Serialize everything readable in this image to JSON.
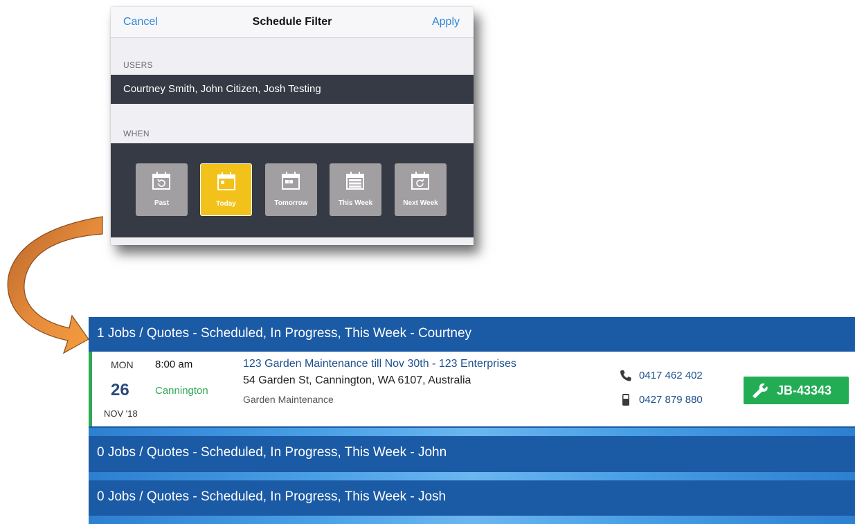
{
  "filter": {
    "cancel_label": "Cancel",
    "title": "Schedule Filter",
    "apply_label": "Apply",
    "users_label": "USERS",
    "users_value": "Courtney Smith, John Citizen, Josh Testing",
    "when_label": "WHEN",
    "when_options": [
      {
        "label": "Past",
        "icon": "calendar-past-icon",
        "selected": false
      },
      {
        "label": "Today",
        "icon": "calendar-today-icon",
        "selected": true
      },
      {
        "label": "Tomorrow",
        "icon": "calendar-tomorrow-icon",
        "selected": false
      },
      {
        "label": "This  Week",
        "icon": "calendar-week-icon",
        "selected": false
      },
      {
        "label": "Next Week",
        "icon": "calendar-next-week-icon",
        "selected": false
      }
    ],
    "selected_color": "#f2c21b"
  },
  "schedule": {
    "groups": [
      {
        "header": "1 Jobs / Quotes - Scheduled, In Progress, This Week - Courtney"
      },
      {
        "header": "0 Jobs / Quotes - Scheduled, In Progress, This Week - John"
      },
      {
        "header": "0 Jobs / Quotes - Scheduled, In Progress, This Week - Josh"
      }
    ],
    "job": {
      "day_of_week": "MON",
      "day": "26",
      "month_year": "NOV  '18",
      "time": "8:00 am",
      "suburb": "Cannington",
      "title": "123 Garden Maintenance till Nov 30th - 123 Enterprises",
      "address": "54 Garden St, Cannington, WA 6107, Australia",
      "category": "Garden Maintenance",
      "phone": "0417 462 402",
      "mobile": "0427 879 880",
      "job_number": "JB-43343"
    },
    "colors": {
      "header_bg": "#1b5aa5",
      "accent_green": "#2eaa56",
      "badge_green": "#22ad55"
    }
  }
}
